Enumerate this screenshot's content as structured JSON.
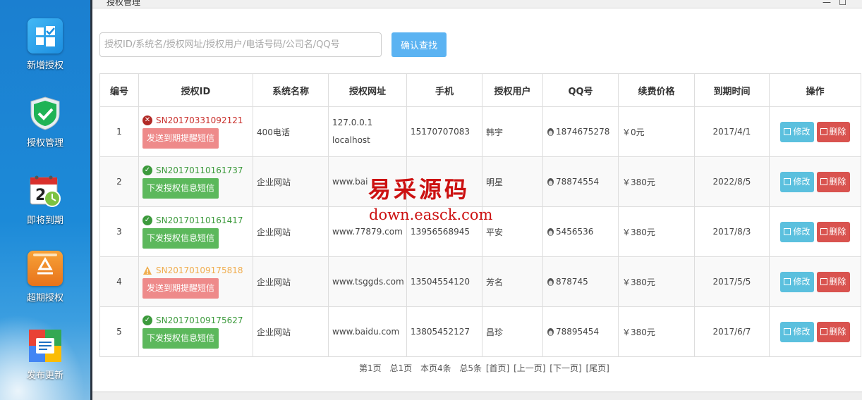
{
  "window": {
    "title": "授权管理",
    "minimize": "—",
    "maximize": "☐"
  },
  "sidebar": {
    "items": [
      {
        "label": "新增授权",
        "icon": "windows-logo-icon"
      },
      {
        "label": "授权管理",
        "icon": "shield-check-icon"
      },
      {
        "label": "即将到期",
        "icon": "calendar-clock-icon"
      },
      {
        "label": "超期授权",
        "icon": "recycle-icon"
      },
      {
        "label": "发布更新",
        "icon": "update-box-icon"
      }
    ]
  },
  "search": {
    "placeholder": "授权ID/系统名/授权网址/授权用户/电话号码/公司名/QQ号",
    "value": "",
    "button": "确认查找"
  },
  "table": {
    "headers": [
      "编号",
      "授权ID",
      "系统名称",
      "授权网址",
      "手机",
      "授权用户",
      "QQ号",
      "续费价格",
      "到期时间",
      "操作"
    ],
    "edit_label": "修改",
    "delete_label": "删除",
    "rows": [
      {
        "no": "1",
        "status": "error",
        "id": "SN20170331092121",
        "sms": "发送到期提醒短信",
        "sys": "400电话",
        "url1": "127.0.0.1",
        "url2": "localhost",
        "phone": "15170707083",
        "user": "韩宇",
        "qq": "1874675278",
        "price": "￥0元",
        "date": "2017/4/1",
        "date_status": "expired"
      },
      {
        "no": "2",
        "status": "ok",
        "id": "SN20170110161737",
        "sms": "下发授权信息短信",
        "sys": "企业网站",
        "url1": "www.bai",
        "url2": "",
        "phone": "",
        "user": "明星",
        "qq": "78874554",
        "price": "￥380元",
        "date": "2022/8/5",
        "date_status": "ok"
      },
      {
        "no": "3",
        "status": "ok",
        "id": "SN20170110161417",
        "sms": "下发授权信息短信",
        "sys": "企业网站",
        "url1": "www.77879.com",
        "url2": "",
        "phone": "13956568945",
        "user": "平安",
        "qq": "5456536",
        "price": "￥380元",
        "date": "2017/8/3",
        "date_status": "ok"
      },
      {
        "no": "4",
        "status": "warn",
        "id": "SN20170109175818",
        "sms": "发送到期提醒短信",
        "sys": "企业网站",
        "url1": "www.tsggds.com",
        "url2": "",
        "phone": "13504554120",
        "user": "芳名",
        "qq": "878745",
        "price": "￥380元",
        "date": "2017/5/5",
        "date_status": "warn"
      },
      {
        "no": "5",
        "status": "ok",
        "id": "SN20170109175627",
        "sms": "下发授权信息短信",
        "sys": "企业网站",
        "url1": "www.baidu.com",
        "url2": "",
        "phone": "13805452127",
        "user": "昌珍",
        "qq": "78895454",
        "price": "￥380元",
        "date": "2017/6/7",
        "date_status": "ok"
      }
    ]
  },
  "pager": {
    "current": "第1页",
    "total_pages": "总1页",
    "this_page": "本页4条",
    "total": "总5条",
    "first": "[首页]",
    "prev": "[上一页]",
    "next": "[下一页]",
    "last": "[尾页]"
  },
  "watermark": {
    "title": "易采源码",
    "url": "down.easck.com"
  },
  "colors": {
    "ok": "#3c9a3c",
    "error": "#c9302c",
    "warn": "#f0ad4e",
    "sidebar": "#1b7fd0",
    "search_button": "#5bb3f2"
  }
}
